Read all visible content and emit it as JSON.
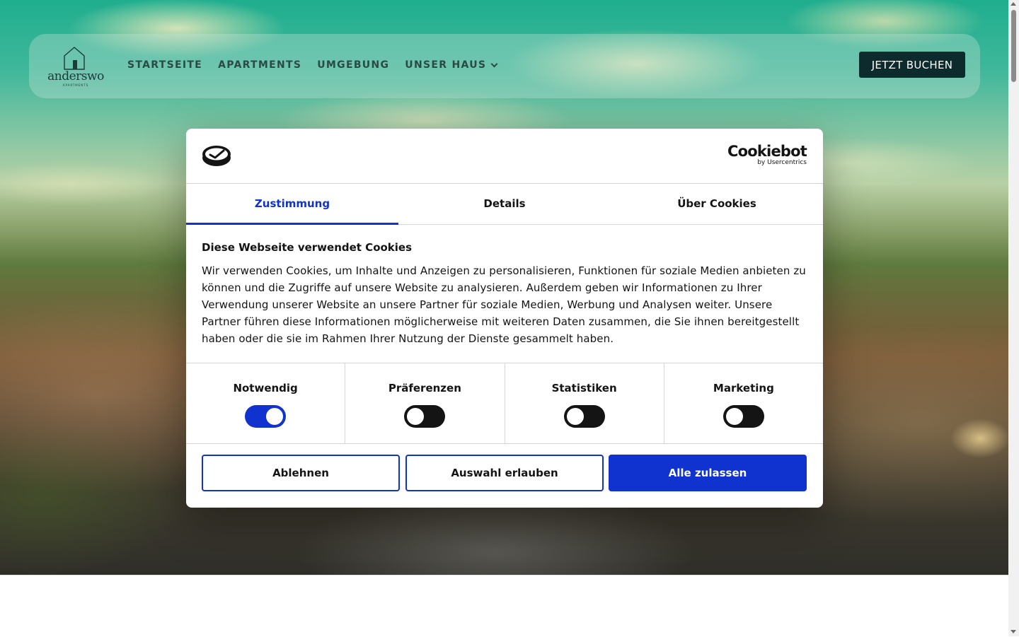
{
  "site": {
    "logo_text": "anderswo",
    "logo_sub": "APARTMENTS",
    "nav": {
      "items": [
        "STARTSEITE",
        "APARTMENTS",
        "UMGEBUNG",
        "UNSER HAUS"
      ],
      "book_label": "JETZT BUCHEN"
    }
  },
  "cookie_dialog": {
    "brand": "Cookiebot",
    "brand_sub": "by Usercentrics",
    "tabs": [
      {
        "label": "Zustimmung",
        "active": true
      },
      {
        "label": "Details",
        "active": false
      },
      {
        "label": "Über Cookies",
        "active": false
      }
    ],
    "title": "Diese Webseite verwendet Cookies",
    "text": "Wir verwenden Cookies, um Inhalte und Anzeigen zu personalisieren, Funktionen für soziale Medien anbieten zu können und die Zugriffe auf unsere Website zu analysieren. Außerdem geben wir Informationen zu Ihrer Verwendung unserer Website an unsere Partner für soziale Medien, Werbung und Analysen weiter. Unsere Partner führen diese Informationen möglicherweise mit weiteren Daten zusammen, die Sie ihnen bereitgestellt haben oder die sie im Rahmen Ihrer Nutzung der Dienste gesammelt haben.",
    "toggles": [
      {
        "label": "Notwendig",
        "checked": true
      },
      {
        "label": "Präferenzen",
        "checked": false
      },
      {
        "label": "Statistiken",
        "checked": false
      },
      {
        "label": "Marketing",
        "checked": false
      }
    ],
    "buttons": {
      "decline": "Ablehnen",
      "allow_selection": "Auswahl erlauben",
      "allow_all": "Alle zulassen"
    }
  },
  "colors": {
    "accent": "#1032cf",
    "nav_button": "#0d2a2c",
    "switch_off": "#141414"
  }
}
